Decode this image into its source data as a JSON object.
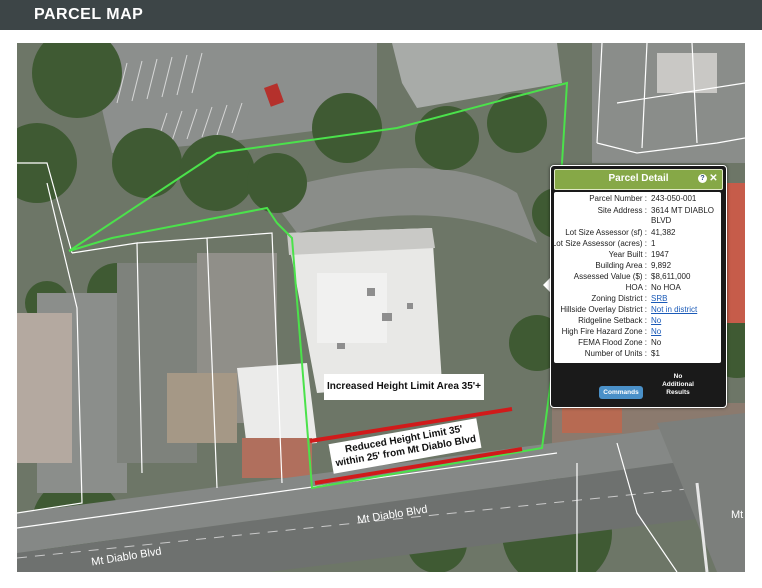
{
  "header": {
    "title": "PARCEL MAP"
  },
  "map": {
    "annotations": {
      "increased": "Increased Height Limit Area 35'+",
      "reduced_line1": "Reduced Height Limit 35'",
      "reduced_line2": "within 25' from Mt Diablo Blvd"
    },
    "roads": [
      "Mt Diablo Blvd",
      "Mt Diablo Blvd",
      "Mt"
    ],
    "colors": {
      "parcel_outline": "#4be24b",
      "lot_lines": "#ffffff",
      "reduced_zone": "#d11a1a"
    }
  },
  "parcel_detail": {
    "title": "Parcel Detail",
    "icons": [
      "info-icon",
      "close-icon"
    ],
    "rows": [
      {
        "label": "Parcel Number :",
        "value": "243-050-001",
        "link": false
      },
      {
        "label": "Site Address :",
        "value": "3614 MT DIABLO",
        "value2": "BLVD",
        "link": false
      },
      {
        "label": "Lot Size Assessor (sf) :",
        "value": "41,382",
        "link": false
      },
      {
        "label": "Lot Size Assessor (acres) :",
        "value": "1",
        "link": false
      },
      {
        "label": "Year Built :",
        "value": "1947",
        "link": false
      },
      {
        "label": "Building Area :",
        "value": "9,892",
        "link": false
      },
      {
        "label": "Assessed Value ($) :",
        "value": "$8,611,000",
        "link": false
      },
      {
        "label": "HOA :",
        "value": "No HOA",
        "link": false
      },
      {
        "label": "Zoning District :",
        "value": "SRB",
        "link": true
      },
      {
        "label": "Hillside Overlay District :",
        "value": "Not in district",
        "link": true
      },
      {
        "label": "Ridgeline Setback :",
        "value": "No",
        "link": true
      },
      {
        "label": "High Fire Hazard Zone :",
        "value": "No",
        "link": true
      },
      {
        "label": "FEMA Flood Zone :",
        "value": "No",
        "link": false
      },
      {
        "label": "Number of Units :",
        "value": "$1",
        "link": false
      }
    ],
    "commands_label": "Commands",
    "no_additional": "No Additional Results"
  }
}
